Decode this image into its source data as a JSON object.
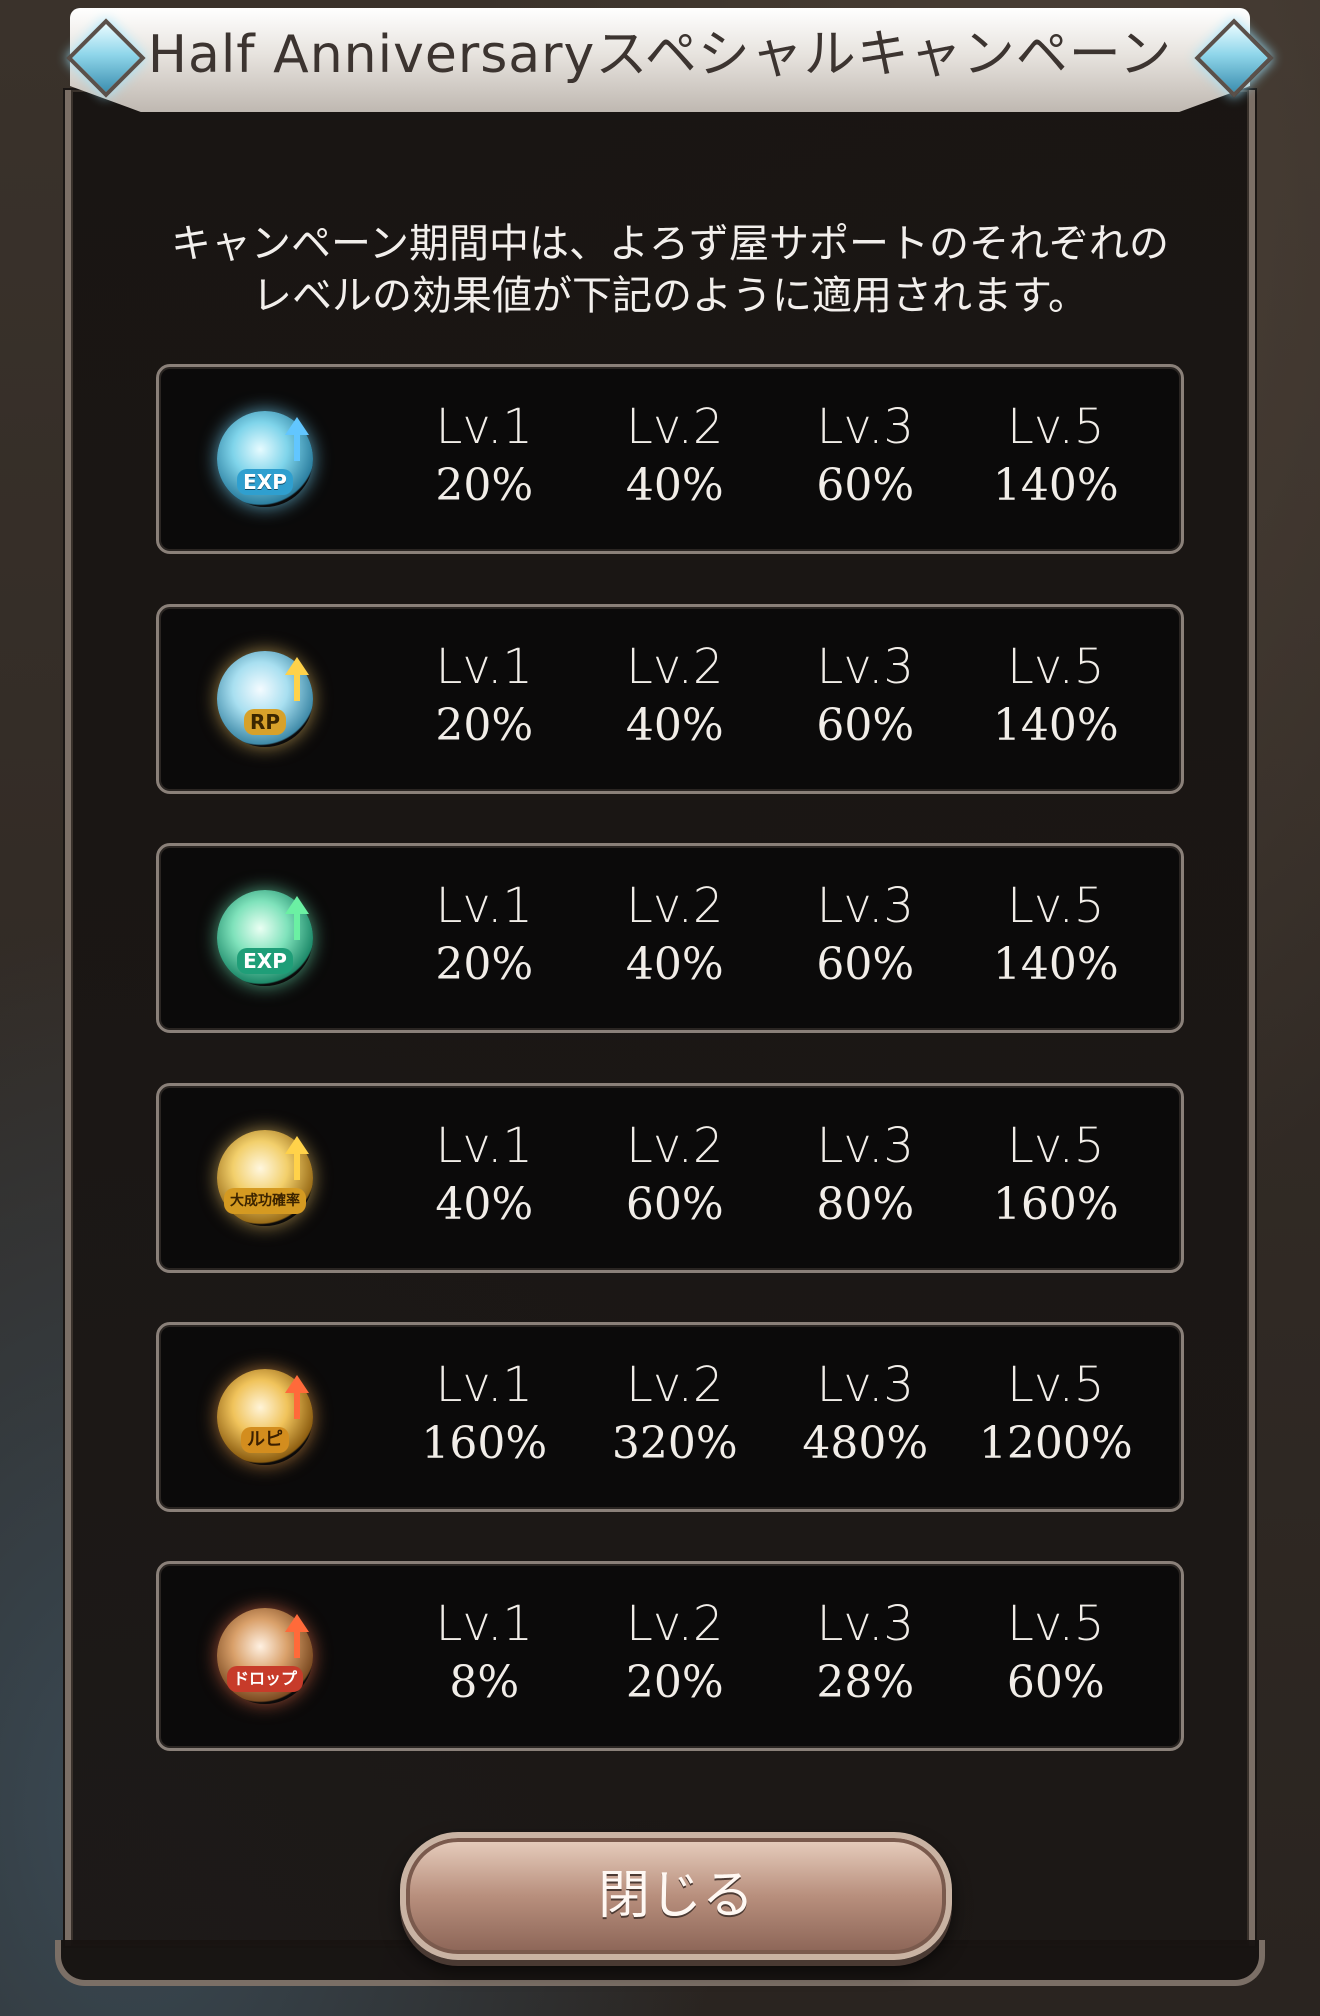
{
  "modal": {
    "title": "Half Anniversaryスペシャルキャンペーン",
    "description_line1": "キャンペーン期間中は、よろず屋サポートのそれぞれの",
    "description_line2": "レベルの効果値が下記のように適用されます。",
    "close_label": "閉じる"
  },
  "rows": [
    {
      "icon": "exp-up-icon",
      "icon_label": "EXP",
      "cells": [
        {
          "lv": "Lv.1",
          "pct": "20%"
        },
        {
          "lv": "Lv.2",
          "pct": "40%"
        },
        {
          "lv": "Lv.3",
          "pct": "60%"
        },
        {
          "lv": "Lv.5",
          "pct": "140%"
        }
      ]
    },
    {
      "icon": "rp-up-icon",
      "icon_label": "RP",
      "cells": [
        {
          "lv": "Lv.1",
          "pct": "20%"
        },
        {
          "lv": "Lv.2",
          "pct": "40%"
        },
        {
          "lv": "Lv.3",
          "pct": "60%"
        },
        {
          "lv": "Lv.5",
          "pct": "140%"
        }
      ]
    },
    {
      "icon": "craft-exp-up-icon",
      "icon_label": "EXP",
      "cells": [
        {
          "lv": "Lv.1",
          "pct": "20%"
        },
        {
          "lv": "Lv.2",
          "pct": "40%"
        },
        {
          "lv": "Lv.3",
          "pct": "60%"
        },
        {
          "lv": "Lv.5",
          "pct": "140%"
        }
      ]
    },
    {
      "icon": "great-success-rate-up-icon",
      "icon_label": "大成功確率",
      "cells": [
        {
          "lv": "Lv.1",
          "pct": "40%"
        },
        {
          "lv": "Lv.2",
          "pct": "60%"
        },
        {
          "lv": "Lv.3",
          "pct": "80%"
        },
        {
          "lv": "Lv.5",
          "pct": "160%"
        }
      ]
    },
    {
      "icon": "rupie-up-icon",
      "icon_label": "ルピ",
      "cells": [
        {
          "lv": "Lv.1",
          "pct": "160%"
        },
        {
          "lv": "Lv.2",
          "pct": "320%"
        },
        {
          "lv": "Lv.3",
          "pct": "480%"
        },
        {
          "lv": "Lv.5",
          "pct": "1200%"
        }
      ]
    },
    {
      "icon": "drop-up-icon",
      "icon_label": "ドロップ",
      "cells": [
        {
          "lv": "Lv.1",
          "pct": "8%"
        },
        {
          "lv": "Lv.2",
          "pct": "20%"
        },
        {
          "lv": "Lv.3",
          "pct": "28%"
        },
        {
          "lv": "Lv.5",
          "pct": "60%"
        }
      ]
    }
  ]
}
